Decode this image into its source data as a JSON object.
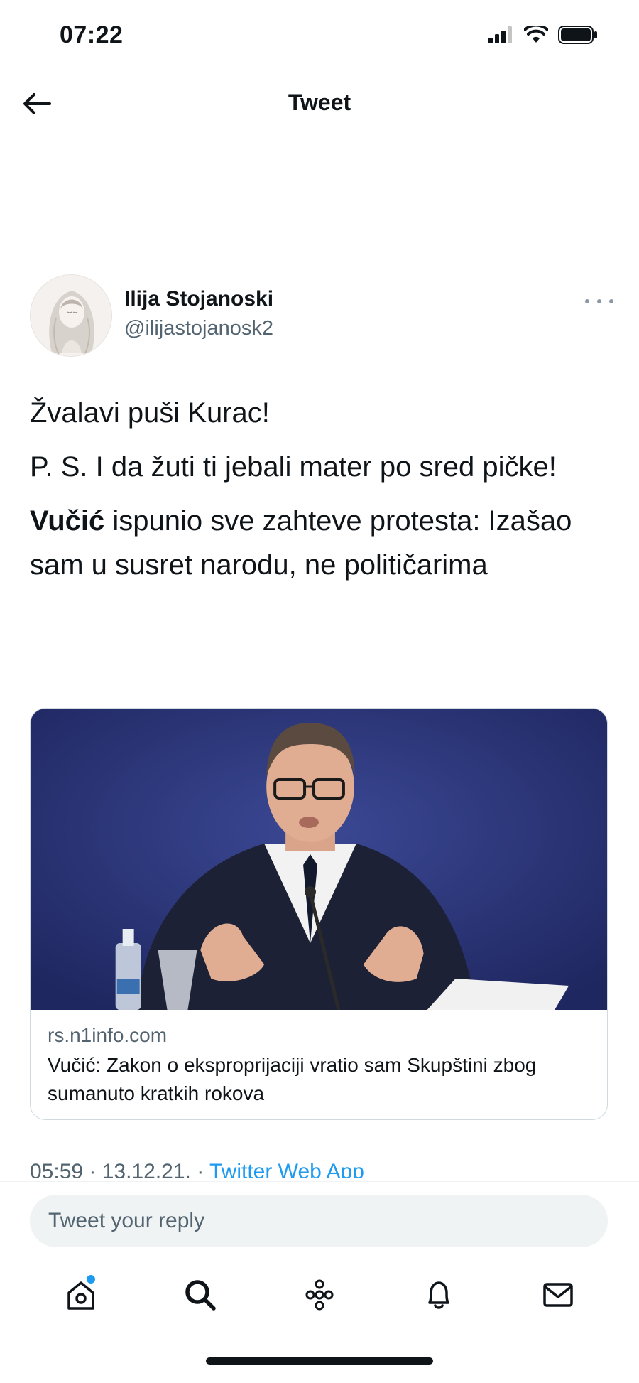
{
  "status_bar": {
    "time": "07:22",
    "icons": [
      "signal-icon",
      "wifi-icon",
      "battery-icon"
    ]
  },
  "header": {
    "title": "Tweet",
    "back_icon": "back-arrow-icon"
  },
  "tweet": {
    "author": {
      "name": "Ilija Stojanoski",
      "handle": "@ilijastojanosk2",
      "avatar_icon": "avatar-illustration"
    },
    "text": {
      "line1": "Žvalavi puši Kurac!",
      "line2": "P. S. I da žuti ti jebali mater po sred pičke!",
      "headline_bold": "Vučić",
      "headline_rest": " ispunio sve zahteve protesta: Izašao sam u susret narodu, ne političarima"
    },
    "link_card": {
      "domain": "rs.n1info.com",
      "title": "Vučić: Zakon o eksproprijaciji vratio sam Skupštini zbog sumanuto kratkih rokova"
    },
    "meta": {
      "time": "05:59",
      "separator": " · ",
      "date": "13.12.21.",
      "separator2": " · ",
      "source": "Twitter Web App"
    }
  },
  "reply": {
    "placeholder": "Tweet your reply"
  },
  "tab_bar": {
    "items": [
      {
        "icon": "home-icon",
        "has_badge": true
      },
      {
        "icon": "search-icon"
      },
      {
        "icon": "spaces-icon"
      },
      {
        "icon": "notifications-icon"
      },
      {
        "icon": "messages-icon"
      }
    ]
  },
  "colors": {
    "accent": "#1d9bf0",
    "text_primary": "#0f1419",
    "text_secondary": "#536471",
    "input_bg": "#eff3f4"
  }
}
